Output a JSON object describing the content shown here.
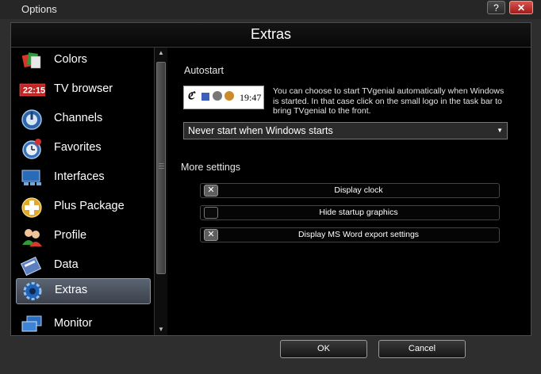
{
  "window": {
    "title": "Options",
    "help_label": "?",
    "close_label": "✕"
  },
  "header": {
    "title": "Extras"
  },
  "sidebar": {
    "items": [
      {
        "label": "Colors",
        "icon": "colors-icon"
      },
      {
        "label": "TV browser",
        "icon": "tv-browser-icon",
        "badge": "22:15"
      },
      {
        "label": "Channels",
        "icon": "channels-icon"
      },
      {
        "label": "Favorites",
        "icon": "favorites-icon"
      },
      {
        "label": "Interfaces",
        "icon": "interfaces-icon"
      },
      {
        "label": "Plus Package",
        "icon": "plus-package-icon"
      },
      {
        "label": "Profile",
        "icon": "profile-icon"
      },
      {
        "label": "Data",
        "icon": "data-icon"
      },
      {
        "label": "Extras",
        "icon": "extras-icon",
        "selected": true
      },
      {
        "label": "Monitor",
        "icon": "monitor-icon"
      }
    ]
  },
  "autostart": {
    "title": "Autostart",
    "tray_time": "19:47",
    "description": "You can choose to start TVgenial automatically when Windows is started. In that case click on the small logo in the task bar to bring TVgenial to the front.",
    "selected_option": "Never start when Windows starts"
  },
  "more_settings": {
    "title": "More settings",
    "options": [
      {
        "label": "Display clock",
        "checked": true
      },
      {
        "label": "Hide startup graphics",
        "checked": false
      },
      {
        "label": "Display MS Word export settings",
        "checked": true
      }
    ]
  },
  "footer": {
    "ok_label": "OK",
    "cancel_label": "Cancel"
  },
  "colors": {
    "selected_bg": "#4a525e",
    "panel_bg": "#000000",
    "frame_bg": "#2e2e2e"
  }
}
